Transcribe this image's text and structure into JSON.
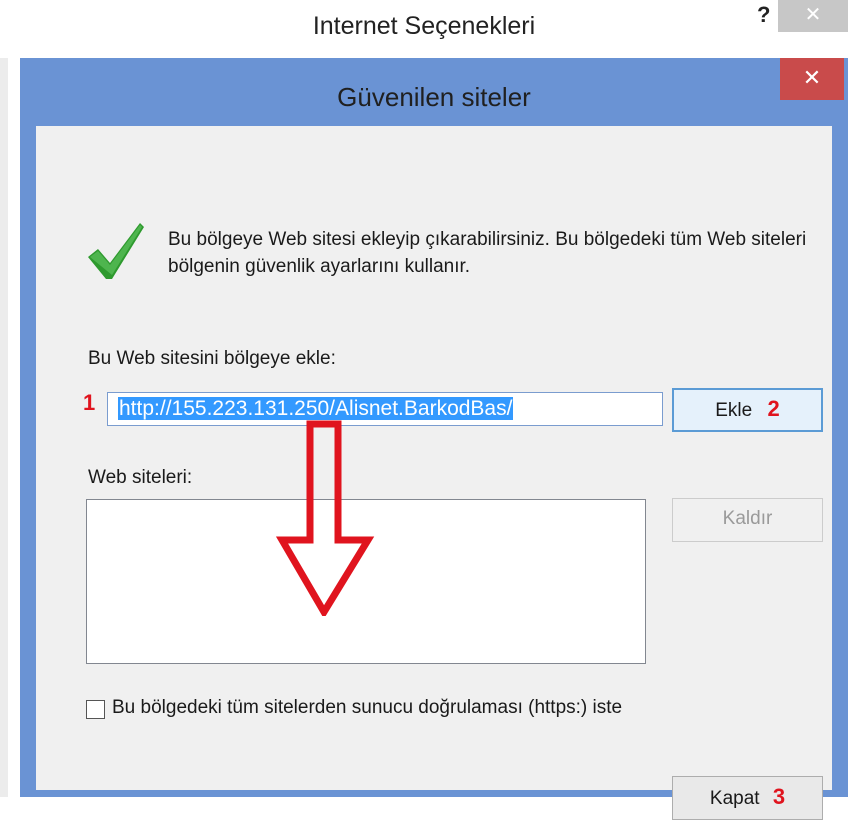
{
  "parent_window": {
    "title": "Internet Seçenekleri",
    "help_label": "?",
    "close_label": "✕"
  },
  "dialog": {
    "title": "Güvenilen siteler",
    "close_label": "✕",
    "description": "Bu bölgeye Web sitesi ekleyip çıkarabilirsiniz. Bu bölgedeki tüm Web siteleri bölgenin güvenlik ayarlarını kullanır.",
    "add_site_label": "Bu Web sitesini bölgeye ekle:",
    "add_site_value": "http://155.223.131.250/Alisnet.BarkodBas/",
    "add_button": "Ekle",
    "websites_label": "Web siteleri:",
    "websites": [],
    "remove_button": "Kaldır",
    "https_checkbox_label": "Bu bölgedeki tüm sitelerden sunucu doğrulaması (https:) iste",
    "https_checked": false,
    "close_button": "Kapat"
  },
  "annotations": {
    "step1": "1",
    "step2": "2",
    "step3": "3",
    "color": "#e0141e"
  },
  "colors": {
    "dialog_frame": "#6a93d4",
    "close_red": "#c94b4b",
    "selection": "#3399ff",
    "check_green": "#2e9a2e"
  }
}
